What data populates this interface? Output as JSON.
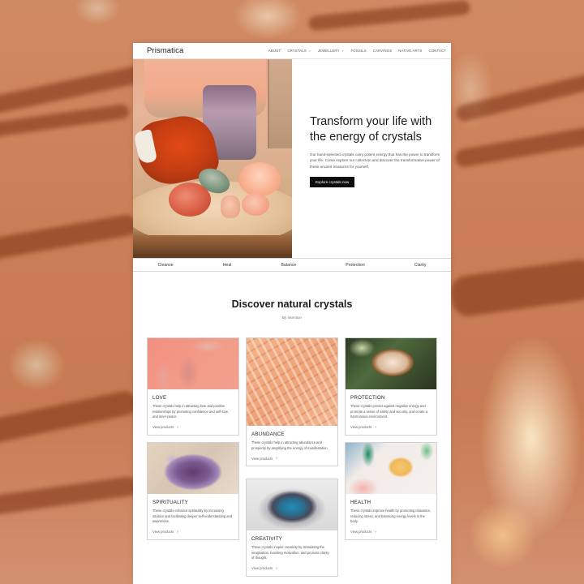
{
  "site": {
    "brand": "Prismatica",
    "nav": [
      {
        "label": "ABOUT",
        "has_dropdown": false
      },
      {
        "label": "CRYSTALS",
        "has_dropdown": true
      },
      {
        "label": "JEWELLERY",
        "has_dropdown": true
      },
      {
        "label": "FOSSILS",
        "has_dropdown": false
      },
      {
        "label": "CARVINGS",
        "has_dropdown": false
      },
      {
        "label": "NATIVE ARTS",
        "has_dropdown": false
      },
      {
        "label": "CONTACT",
        "has_dropdown": false
      }
    ],
    "dropdown_icon": "chevron-down-icon"
  },
  "hero": {
    "title": "Transform your life with the energy of crystals",
    "description": "Our hand-selected crystals carry potent energy that has the power to transform your life. Come explore our collection and discover the transformative power of these ancient treasures for yourself.",
    "button_label": "Explore crystals now",
    "image_alt": "Assorted crystals on a wooden slab"
  },
  "intentions": [
    "Cleanse",
    "Heal",
    "Balance",
    "Protection",
    "Clarity"
  ],
  "discover": {
    "title": "Discover natural crystals",
    "subtitle": "By intention",
    "link_label": "View products",
    "link_icon": "chevron-right-icon",
    "cards": [
      {
        "key": "love",
        "title": "LOVE",
        "description": "These crystals help in attracting love and positive relationships by promoting confidence and self-love, and inner-peace."
      },
      {
        "key": "abundance",
        "title": "ABUNDANCE",
        "description": "These crystals help in attracting abundance and prosperity by amplifying the energy of manifestation."
      },
      {
        "key": "protection",
        "title": "PROTECTION",
        "description": "These crystals protect against negative energy and promote a sense of safety and security, and create a harmonious environment."
      },
      {
        "key": "spirituality",
        "title": "SPIRITUALITY",
        "description": "These crystals enhance spirituality by increasing intuition and facilitating deeper self-understanding and awareness."
      },
      {
        "key": "creativity",
        "title": "CREATIVITY",
        "description": "These crystals inspire creativity by stimulating the imagination, boosting motivation, and promote clarity of thought."
      },
      {
        "key": "health",
        "title": "HEALTH",
        "description": "These crystals improve health by promoting relaxation, reducing stress, and balancing energy levels in the body."
      }
    ]
  }
}
